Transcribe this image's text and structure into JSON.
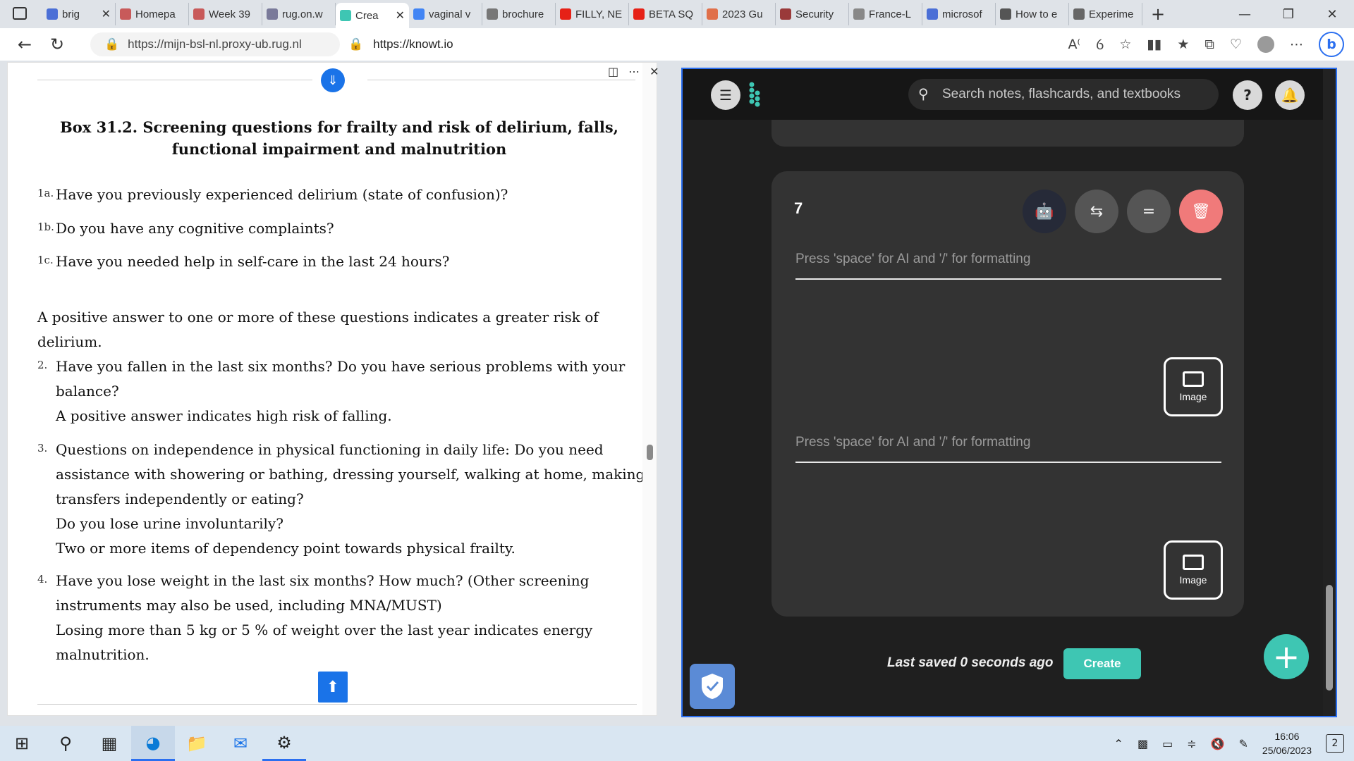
{
  "browser": {
    "tabs": [
      {
        "label": "brig",
        "icon": "tab-favicon",
        "color": "#4b6fd6"
      },
      {
        "label": "Homepa",
        "icon": "tab-favicon",
        "color": "#c85a5a"
      },
      {
        "label": "Week 39",
        "icon": "tab-favicon",
        "color": "#c85a5a"
      },
      {
        "label": "rug.on.w",
        "icon": "tab-favicon",
        "color": "#7a7a9a"
      },
      {
        "label": "Crea",
        "icon": "tab-favicon",
        "color": "#3ec6b3",
        "active": true
      },
      {
        "label": "vaginal v",
        "icon": "google-icon",
        "color": "#4285f4"
      },
      {
        "label": "brochure",
        "icon": "doc-icon",
        "color": "#777777"
      },
      {
        "label": "FILLY, NE",
        "icon": "youtube-icon",
        "color": "#e62117"
      },
      {
        "label": "BETA SQ",
        "icon": "youtube-icon",
        "color": "#e62117"
      },
      {
        "label": "2023 Gu",
        "icon": "reddit-icon",
        "color": "#e0704a"
      },
      {
        "label": "Security",
        "icon": "tab-favicon",
        "color": "#9a3a3a"
      },
      {
        "label": "France-L",
        "icon": "tab-favicon",
        "color": "#888888"
      },
      {
        "label": "microsof",
        "icon": "search-icon",
        "color": "#4b6fd6"
      },
      {
        "label": "How to e",
        "icon": "tab-favicon",
        "color": "#555555"
      },
      {
        "label": "Experime",
        "icon": "flask-icon",
        "color": "#666666"
      }
    ],
    "url_left": "https://mijn-bsl-nl.proxy-ub.rug.nl",
    "url_right": "https://knowt.io"
  },
  "document": {
    "box_title": "Box 31.2. Screening questions for frailty and risk of delirium, falls, functional impairment and malnutrition",
    "q1a_num": "1a.",
    "q1a": "Have you previously experienced delirium (state of confusion)?",
    "q1b_num": "1b.",
    "q1b": "Do you have any cognitive complaints?",
    "q1c_num": "1c.",
    "q1c": "Have you needed help in self-care in the last 24 hours?",
    "para1_line1": "A positive answer to one or more of these questions indicates a greater risk of",
    "para1_line2": "delirium.",
    "q2_num": "2.",
    "q2_line1": "Have you fallen in the last six months? Do you have serious problems with your",
    "q2_line2": "balance?",
    "q2_line3": "A positive answer indicates high risk of falling.",
    "q3_num": "3.",
    "q3_line1": "Questions on independence in physical functioning in daily life: Do you need",
    "q3_line2": "assistance with showering or bathing, dressing yourself, walking at home, making",
    "q3_line3": "transfers independently or eating?",
    "q3_line4": "Do you lose urine involuntarily?",
    "q3_line5": "Two or more items of dependency point towards physical frailty.",
    "q4_num": "4.",
    "q4_line1": "Have you lose weight in the last six months? How much? (Other screening",
    "q4_line2": "instruments may also be used, including MNA/MUST)",
    "q4_line3": "Losing more than 5 kg or 5 % of weight over the last year indicates energy",
    "q4_line4": "malnutrition."
  },
  "knowt": {
    "search_placeholder": "Search notes, flashcards, and textbooks",
    "help_label": "?",
    "card_number": "7",
    "term_placeholder": "Press 'space' for AI and '/' for formatting",
    "definition_placeholder": "Press 'space' for AI and '/' for formatting",
    "image_label_1": "Image",
    "image_label_2": "Image",
    "saved_text": "Last saved 0 seconds ago",
    "create_label": "Create",
    "accent_color": "#3ec6b3",
    "delete_color": "#f07a7a"
  },
  "taskbar": {
    "time": "16:06",
    "date": "25/06/2023",
    "notification_count": "2"
  }
}
